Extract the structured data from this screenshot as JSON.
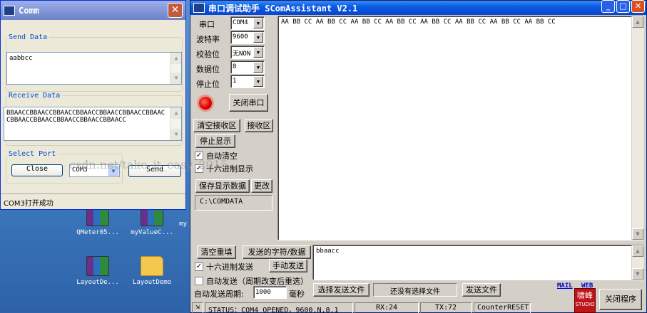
{
  "desktop": {
    "icons": [
      {
        "label": "QMeter05..."
      },
      {
        "label": "myValueC..."
      },
      {
        "label": "my"
      },
      {
        "label": "LayoutDe..."
      },
      {
        "label": "LayoutDemo"
      }
    ]
  },
  "comm": {
    "title": "Comm",
    "close_glyph": "✕",
    "send_group": "Send Data",
    "send_text": "aabbcc",
    "receive_group": "Receive Data",
    "receive_text": "BBAACCBBAACCBBAACCBBAACCBBAACCBBAACCBBAACCBBAACCBBAACCBBAACCBBAACCBBAACC",
    "port_group": "Select Port",
    "close_btn": "Close",
    "port_value": "COM3",
    "send_btn": "Send",
    "status": "COM3打开成功"
  },
  "scom": {
    "title": "串口调试助手 SComAssistant V2.1",
    "win_min": "_",
    "win_max": "□",
    "win_close": "✕",
    "labels": {
      "port": "串口",
      "baud": "波特率",
      "parity": "校验位",
      "databits": "数据位",
      "stopbits": "停止位"
    },
    "values": {
      "port": "COM4",
      "baud": "9600",
      "parity": "无NON",
      "databits": "8",
      "stopbits": "1"
    },
    "close_port_btn": "关闭串口",
    "clear_recv_btn": "清空接收区",
    "recv_area_btn": "接收区",
    "stop_display_btn": "停止显示",
    "auto_clear": "自动清空",
    "hex_display": "十六进制显示",
    "save_display_btn": "保存显示数据",
    "change_btn": "更改",
    "save_path": "C:\\COMDATA",
    "receive_text": "AA BB CC AA BB CC AA BB CC AA BB CC AA BB CC AA BB CC AA BB CC AA BB CC",
    "clear_resend_btn": "清空重填",
    "send_chars_btn": "发送的字符/数据",
    "send_text": "bbaacc",
    "hex_send": "十六进制发送",
    "manual_send_btn": "手动发送",
    "auto_send": "自动发送（周期改变后重选）",
    "auto_period_label": "自动发送周期:",
    "auto_period_value": "1000",
    "ms_unit": "毫秒",
    "select_file_btn": "选择发送文件",
    "no_file_text": "还没有选择文件",
    "send_file_btn": "发送文件",
    "mail": "MAIL",
    "web": "WEB",
    "logo_text": "啸峰",
    "logo_sub": "STUDIO",
    "exit_btn": "关闭程序",
    "status_text": "STATUS：COM4 OPENED，9600,N,8,1",
    "rx": "RX:24",
    "tx": "TX:72",
    "counter_reset": "CounterRESET"
  },
  "watermark": "csdn.net/take_it_easy_2015"
}
